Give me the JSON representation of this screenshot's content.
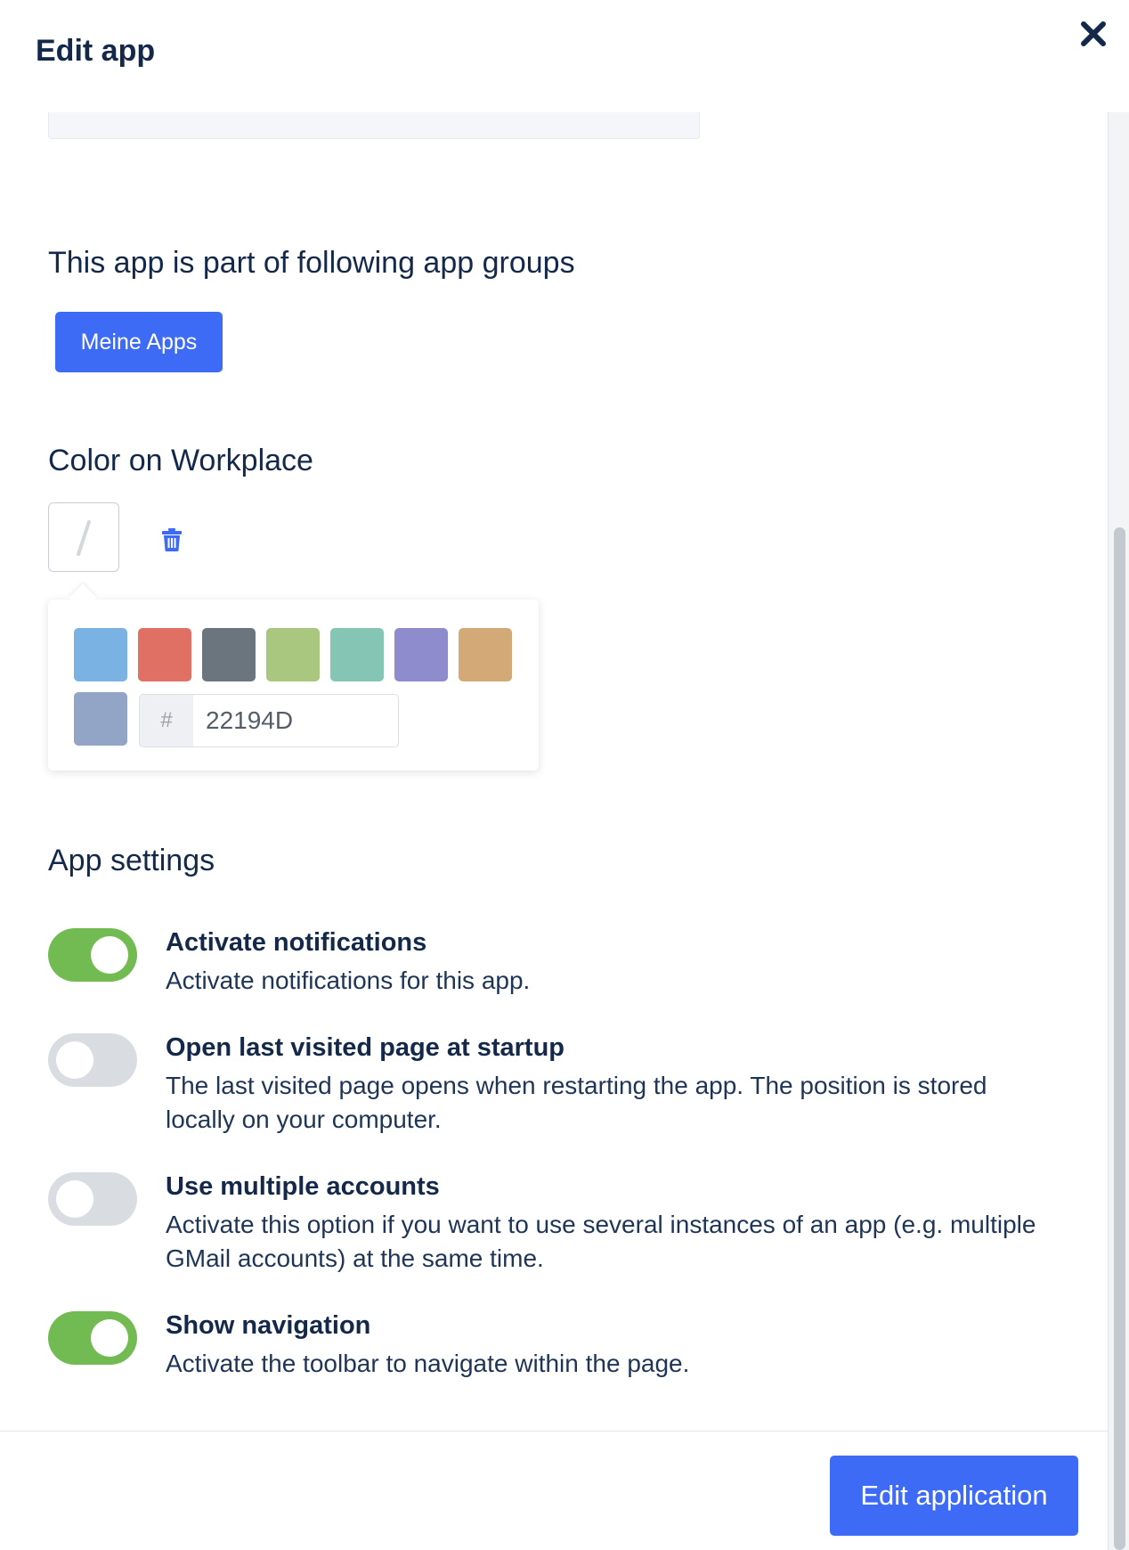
{
  "header": {
    "title": "Edit app"
  },
  "icons": {
    "close": "close-icon",
    "trash": "trash-icon"
  },
  "app_groups": {
    "title": "This app is part of following app groups",
    "groups": [
      "Meine Apps"
    ]
  },
  "color": {
    "title": "Color on Workplace",
    "swatches": [
      "#7ab3e3",
      "#e07063",
      "#6a757d",
      "#a9c77e",
      "#85c5b4",
      "#8e8ccc",
      "#d4a978",
      "#92a5c6"
    ],
    "hex_prefix": "#",
    "hex_value": "22194D"
  },
  "settings": {
    "title": "App settings",
    "items": [
      {
        "title": "Activate notifications",
        "description": "Activate notifications for this app.",
        "enabled": true
      },
      {
        "title": "Open last visited page at startup",
        "description": "The last visited page opens when restarting the app. The position is stored locally on your computer.",
        "enabled": false
      },
      {
        "title": "Use multiple accounts",
        "description": "Activate this option if you want to use several instances of an app (e.g. multiple GMail accounts) at the same time.",
        "enabled": false
      },
      {
        "title": "Show navigation",
        "description": "Activate the toolbar to navigate within the page.",
        "enabled": true
      }
    ]
  },
  "footer": {
    "submit_label": "Edit application"
  },
  "colors": {
    "primary": "#3d6bf5",
    "toggle_on": "#72bb53",
    "toggle_off": "#d9dde2",
    "text": "#14294a"
  }
}
